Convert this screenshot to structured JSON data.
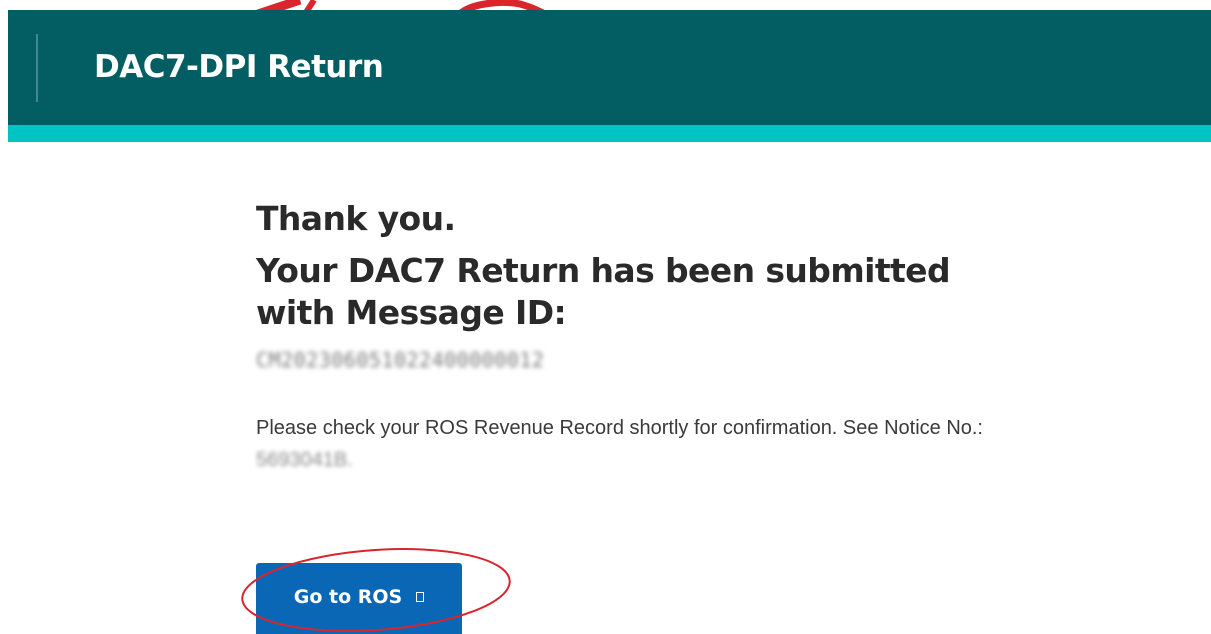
{
  "header": {
    "title": "DAC7-DPI Return"
  },
  "confirmation": {
    "heading": "Thank you.",
    "submitted_text": "Your DAC7 Return has been submitted with Message ID:",
    "message_id": "CM202306051022400000012",
    "notice_text": "Please check your ROS Revenue Record shortly for confirmation. See Notice No.:",
    "notice_number": "5693041B."
  },
  "actions": {
    "go_to_ros_label": "Go to ROS"
  },
  "icons": {
    "external_link": "external-link-icon"
  },
  "colors": {
    "header_bg": "#035e63",
    "header_accent": "#00c4c4",
    "button_bg": "#0a67b6",
    "annotation": "#d9252b"
  }
}
